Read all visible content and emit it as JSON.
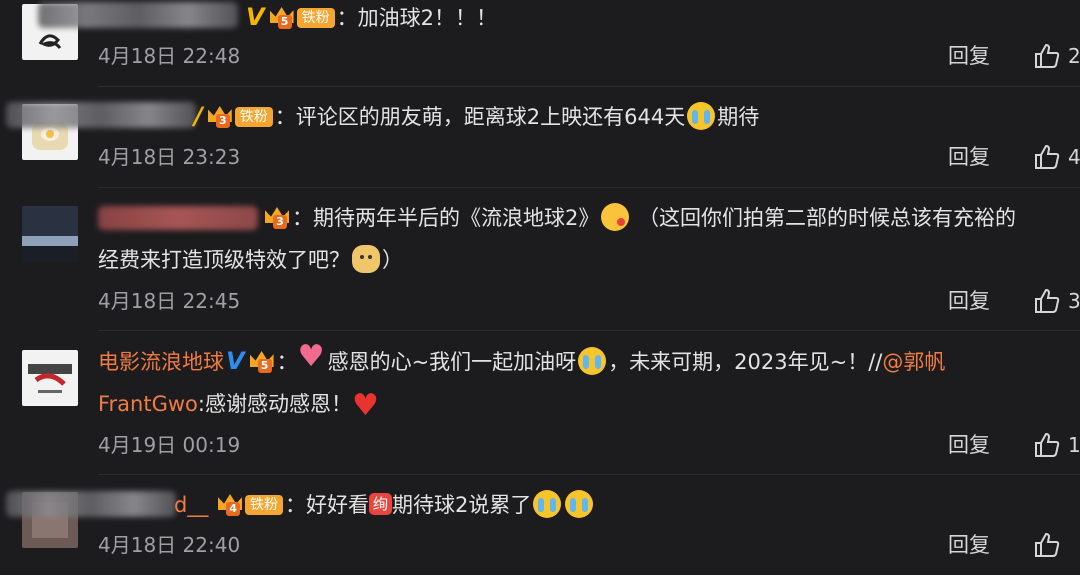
{
  "comments": [
    {
      "badge_level": "5",
      "fan_label": "铁粉",
      "text": "：加油球2！！！",
      "time": "4月18日 22:48",
      "reply": "回复",
      "likes": "2"
    },
    {
      "badge_level": "3",
      "fan_label": "铁粉",
      "text_a": "：评论区的朋友萌，距离球2上映还有644天",
      "text_b": "期待",
      "time": "4月18日 23:23",
      "reply": "回复",
      "likes": "4"
    },
    {
      "badge_level": "3",
      "text_a": "：期待两年半后的《流浪地球2》",
      "text_b": "（这回你们拍第二部的时候总该有充裕的",
      "text_c": "经费来打造顶级特效了吧？",
      "text_d": "）",
      "time": "4月18日 22:45",
      "reply": "回复",
      "likes": "3"
    },
    {
      "username": "电影流浪地球",
      "badge_level": "5",
      "text_a": "：",
      "text_b": "感恩的心~我们一起加油呀",
      "text_c": "，未来可期，2023年见~！//",
      "mention": "@郭帆",
      "mention_b": "FrantGwo",
      "text_d": ":感谢感动感恩！",
      "time": "4月19日 00:19",
      "reply": "回复",
      "likes": "1"
    },
    {
      "username_tail": "d__",
      "badge_level": "4",
      "fan_label": "铁粉",
      "text_a": "：好好看",
      "sticker": "绚",
      "text_b": "期待球2说累了",
      "time": "4月18日 22:40",
      "reply": "回复",
      "likes": ""
    }
  ]
}
